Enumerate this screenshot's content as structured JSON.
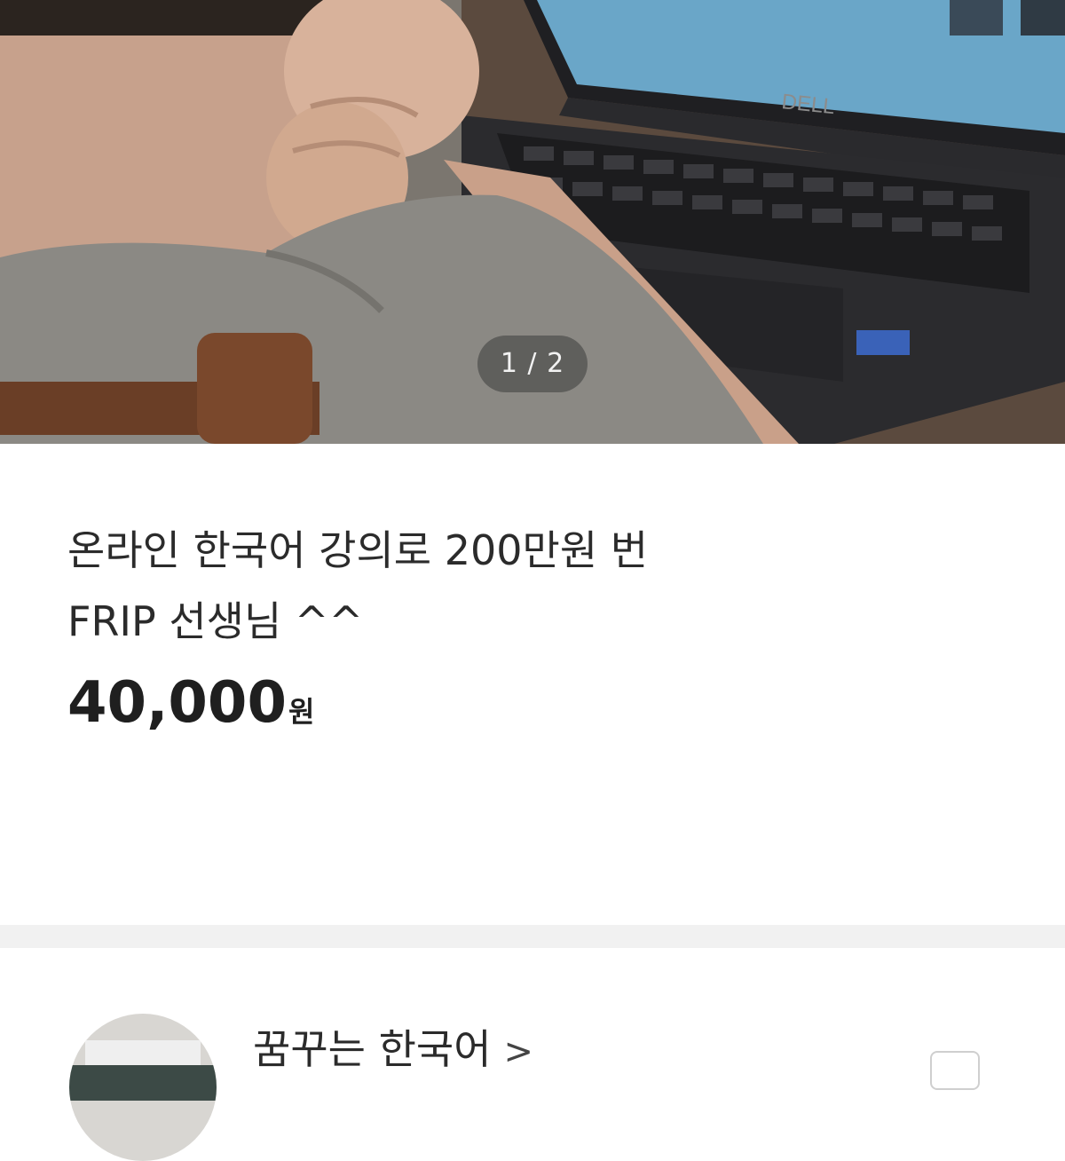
{
  "hero": {
    "pager_text": "1 / 2",
    "laptop_logo": "DELL"
  },
  "product": {
    "title_line1": "온라인 한국어 강의로 200만원 번",
    "title_line2": "FRIP 선생님 ^^",
    "price_value": "40,000",
    "price_unit": "원"
  },
  "seller": {
    "name": "꿈꾸는 한국어",
    "chevron": ">"
  }
}
